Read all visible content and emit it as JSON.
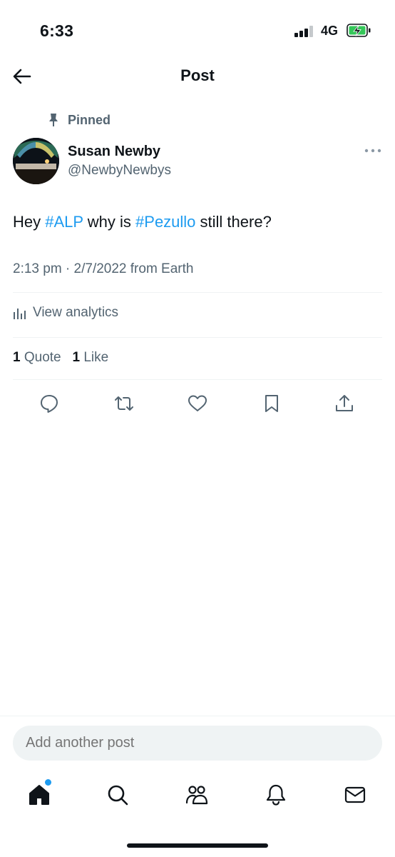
{
  "status_bar": {
    "time": "6:33",
    "network": "4G"
  },
  "header": {
    "title": "Post"
  },
  "post": {
    "pinned_label": "Pinned",
    "author_name": "Susan Newby",
    "author_handle": "@NewbyNewbys",
    "text_before": "Hey ",
    "hashtag1": "#ALP",
    "text_middle": " why is ",
    "hashtag2": "#Pezullo",
    "text_after": " still there?",
    "meta": "2:13 pm · 2/7/2022 from Earth",
    "analytics_label": "View analytics",
    "quote_count": "1",
    "quote_label": "Quote",
    "like_count": "1",
    "like_label": "Like"
  },
  "actions": [
    "reply-icon",
    "repost-icon",
    "like-icon",
    "bookmark-icon",
    "share-icon"
  ],
  "compose": {
    "placeholder": "Add another post"
  },
  "bottom_nav": [
    "home-icon",
    "search-icon",
    "communities-icon",
    "notifications-icon",
    "messages-icon"
  ],
  "colors": {
    "accent": "#1d9bf0",
    "text": "#0f1419",
    "secondary": "#536471",
    "battery": "#34c759"
  }
}
